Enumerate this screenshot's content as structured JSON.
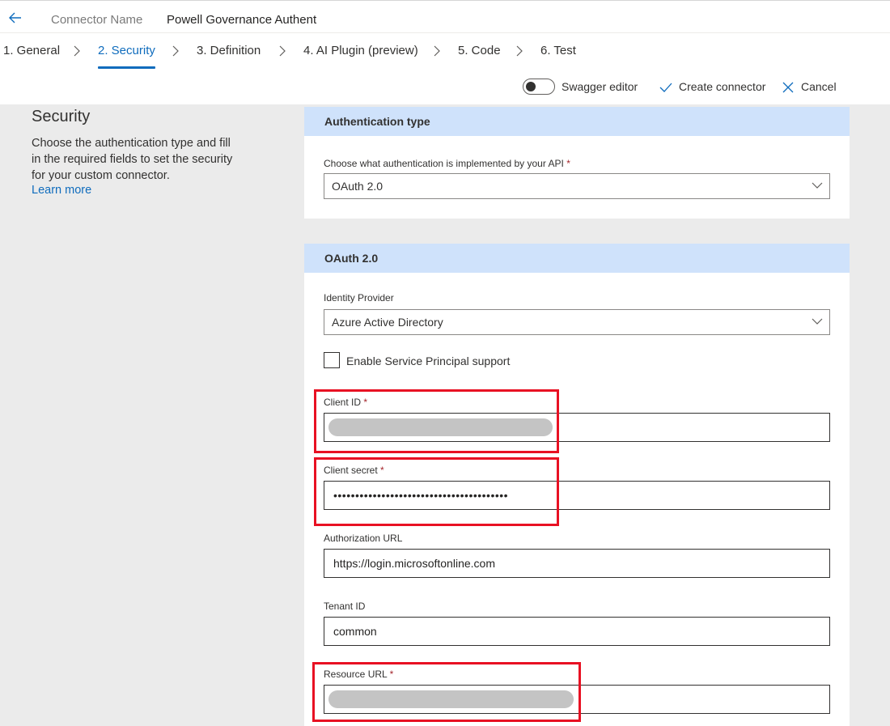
{
  "header": {
    "connector_label": "Connector Name",
    "connector_value": "Powell Governance Authent"
  },
  "steps": [
    {
      "label": "1. General"
    },
    {
      "label": "2. Security"
    },
    {
      "label": "3. Definition"
    },
    {
      "label": "4. AI Plugin (preview)"
    },
    {
      "label": "5. Code"
    },
    {
      "label": "6. Test"
    }
  ],
  "toolbar": {
    "swagger_label": "Swagger editor",
    "create_label": "Create connector",
    "cancel_label": "Cancel"
  },
  "sidebar": {
    "title": "Security",
    "description": "Choose the authentication type and fill in the required fields to set the security for your custom connector.",
    "learn_more": "Learn more"
  },
  "auth_card": {
    "header": "Authentication type",
    "field_label": "Choose what authentication is implemented by your API",
    "required_mark": "*",
    "selected": "OAuth 2.0"
  },
  "oauth_card": {
    "header": "OAuth 2.0",
    "identity_provider_label": "Identity Provider",
    "identity_provider_value": "Azure Active Directory",
    "service_principal_label": "Enable Service Principal support",
    "client_id_label": "Client ID",
    "client_secret_label": "Client secret",
    "client_secret_value": "••••••••••••••••••••••••••••••••••••••••",
    "authorization_url_label": "Authorization URL",
    "authorization_url_value": "https://login.microsoftonline.com",
    "tenant_id_label": "Tenant ID",
    "tenant_id_value": "common",
    "resource_url_label": "Resource URL",
    "required_mark": "*"
  },
  "colors": {
    "accent": "#0f6cbd",
    "card_header": "#cfe2fb",
    "highlight": "#e81123",
    "background": "#ebebeb"
  }
}
